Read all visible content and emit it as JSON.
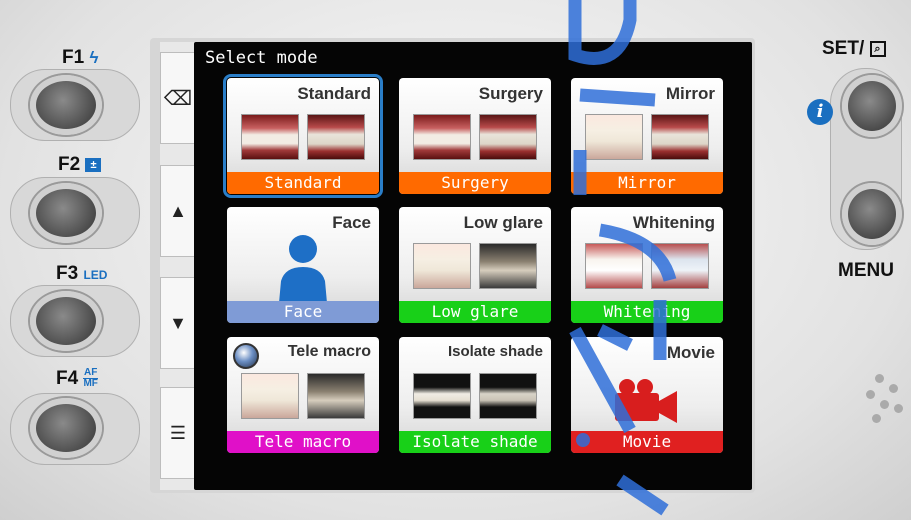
{
  "screen": {
    "title": "Select mode"
  },
  "side_buttons": [
    {
      "icon": "backspace-icon",
      "glyph": "⌫"
    },
    {
      "icon": "arrow-up-icon",
      "glyph": "▲"
    },
    {
      "icon": "arrow-down-icon",
      "glyph": "▼"
    },
    {
      "icon": "list-icon",
      "glyph": "☰"
    }
  ],
  "tiles": [
    {
      "heading": "Standard",
      "label": "Standard",
      "color": "#ff6a00",
      "selected": true
    },
    {
      "heading": "Surgery",
      "label": "Surgery",
      "color": "#ff6a00"
    },
    {
      "heading": "Mirror",
      "label": "Mirror",
      "color": "#ff6a00"
    },
    {
      "heading": "Face",
      "label": "Face",
      "color": "#7f9bd6"
    },
    {
      "heading": "Low glare",
      "label": "Low glare",
      "color": "#18d018"
    },
    {
      "heading": "Whitening",
      "label": "Whitening",
      "color": "#18d018"
    },
    {
      "heading": "Tele macro",
      "label": "Tele macro",
      "color": "#e010c8"
    },
    {
      "heading": "Isolate shade",
      "label": "Isolate shade",
      "color": "#18d018"
    },
    {
      "heading": "Movie",
      "label": "Movie",
      "color": "#e02020"
    }
  ],
  "hardware": {
    "f1": "F1",
    "f2": "F2",
    "f3": "F3",
    "f3_sub": "LED",
    "f4": "F4",
    "f4_sub_top": "AF",
    "f4_sub_bottom": "MF",
    "set": "SET/",
    "menu": "MENU",
    "info": "i"
  },
  "colors": {
    "accent": "#2a7ec8",
    "info_blue": "#1a6fc0",
    "watermark": "#2f6fd8"
  }
}
